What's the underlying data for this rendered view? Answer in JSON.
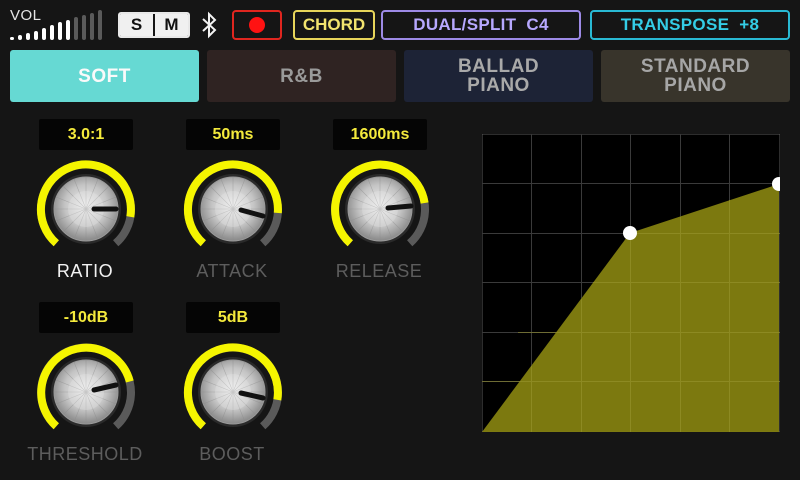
{
  "topbar": {
    "vol_label": "VOL",
    "volume_level": 0.5,
    "solo_label": "S",
    "mute_label": "M",
    "bluetooth_icon": "bluetooth-icon",
    "record_icon": "record-icon",
    "chord_label": "CHORD",
    "dual_split_label": "DUAL/SPLIT  C4",
    "transpose_label": "TRANSPOSE  +8"
  },
  "presets": [
    {
      "label": "SOFT",
      "active": true
    },
    {
      "label": "R&B",
      "active": false
    },
    {
      "label": "BALLAD\nPIANO",
      "active": false
    },
    {
      "label": "STANDARD\nPIANO",
      "active": false
    }
  ],
  "knobs": {
    "ratio": {
      "value": "3.0:1",
      "label": "RATIO"
    },
    "attack": {
      "value": "50ms",
      "label": "ATTACK"
    },
    "release": {
      "value": "1600ms",
      "label": "RELEASE"
    },
    "threshold": {
      "value": "-10dB",
      "label": "THRESHOLD"
    },
    "boost": {
      "value": "5dB",
      "label": "BOOST"
    }
  },
  "colors": {
    "accent_yellow": "#f5f500",
    "fill_olive": "#838010",
    "preset_active": "#66d9d3",
    "record_red": "#ff1212"
  }
}
